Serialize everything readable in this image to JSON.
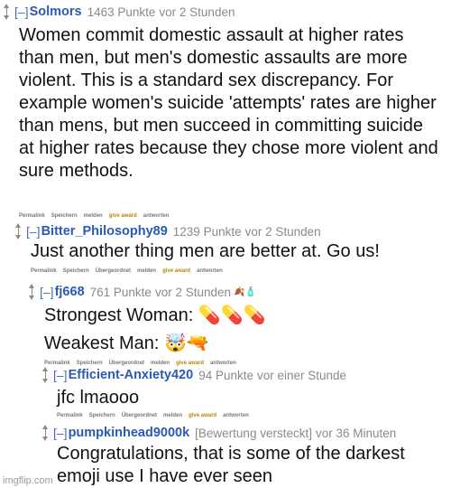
{
  "comments": [
    {
      "collapse": "[–]",
      "author": "Solmors",
      "points": "1463 Punkte",
      "time": "vor 2 Stunden",
      "body": "Women commit domestic assault at higher rates than men, but men's domestic assaults are more violent. This is a standard sex discrepancy. For example women's suicide 'attempts' rates are higher than mens, but men succeed in committing suicide at higher rates because they chose more violent and sure methods.",
      "actions": [
        "Permalink",
        "Speichern",
        "melden",
        "give award",
        "antworten"
      ]
    },
    {
      "collapse": "[–]",
      "author": "Bitter_Philosophy89",
      "points": "1239 Punkte",
      "time": "vor 2 Stunden",
      "body": "Just another thing men are better at. Go us!",
      "actions": [
        "Permalink",
        "Speichern",
        "Übergeordnet",
        "melden",
        "give award",
        "antworten"
      ]
    },
    {
      "collapse": "[–]",
      "author": "fj668",
      "points": "761 Punkte",
      "time": "vor 2 Stunden",
      "flair_icons": "🍂🧴",
      "line1": "Strongest Woman: 💊💊💊",
      "line2": "Weakest Man: 🤯🔫",
      "actions": [
        "Permalink",
        "Speichern",
        "Übergeordnet",
        "melden",
        "give award",
        "antworten"
      ]
    },
    {
      "collapse": "[–]",
      "author": "Efficient-Anxiety420",
      "points": "94 Punkte",
      "time": "vor einer Stunde",
      "body": "jfc lmaooo",
      "actions": [
        "Permalink",
        "Speichern",
        "Übergeordnet",
        "melden",
        "give award",
        "antworten"
      ]
    },
    {
      "collapse": "[–]",
      "author": "pumpkinhead9000k",
      "points": "[Bewertung versteckt]",
      "time": "vor 36 Minuten",
      "body": "Congratulations, that is some of the darkest emoji use I have ever seen"
    }
  ],
  "watermark": "imgflip.com",
  "colors": {
    "author": "#2a5ab8",
    "meta": "#8a8a8a",
    "award": "#b8860b"
  }
}
